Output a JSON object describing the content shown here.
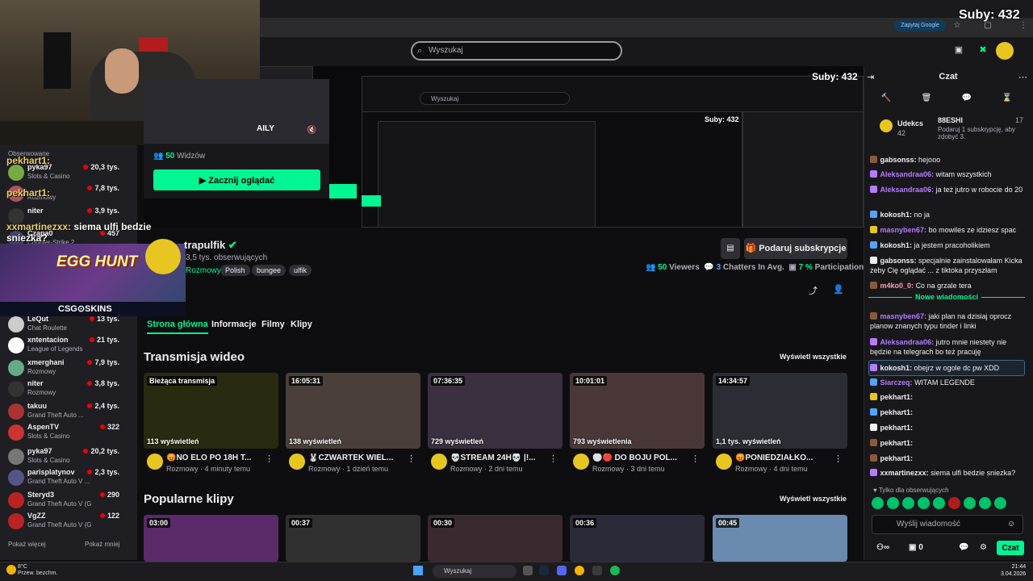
{
  "overlay": {
    "subs_counter": "Suby: 432",
    "nested_subs": "Suby: 432",
    "nested_subs_small": "Suby: 432"
  },
  "browser": {
    "google_btn": "Zapytaj Google"
  },
  "search": {
    "placeholder": "Wyszukaj",
    "nested_placeholder": "Wyszukaj"
  },
  "stream_overlay": {
    "lines": [
      {
        "user": "pekhart1:",
        "msg": ""
      },
      {
        "user": "pekhart1:",
        "msg": ""
      },
      {
        "user": "xxmartinezxx:",
        "msg": "siema ulfi bedzie sniezka?"
      }
    ],
    "egg_hunt": "EGG HUNT",
    "csgoskins": "CSG⊙SKINS",
    "followed_label": "Obserwowane"
  },
  "preview": {
    "caption": "AILY",
    "viewers_count": "50",
    "viewers_label": "Widzów",
    "watch_btn": "Zacznij oglądać"
  },
  "sidebar": {
    "channels": [
      {
        "name": "pyka97",
        "category": "Slots & Casino",
        "viewers": "20,3 tys."
      },
      {
        "name": "",
        "category": "Rozmowy",
        "viewers": "7,8 tys."
      },
      {
        "name": "niter",
        "category": "",
        "viewers": "3,9 tys."
      },
      {
        "name": "Czapa0",
        "category": "Counter-Strike 2",
        "viewers": "457"
      },
      {
        "name": "LeQut",
        "category": "Chat Roulette",
        "viewers": "13 tys."
      },
      {
        "name": "xntentacion",
        "category": "League of Legends",
        "viewers": "21 tys."
      },
      {
        "name": "xmerghani",
        "category": "Rozmowy",
        "viewers": "7,9 tys."
      },
      {
        "name": "niter",
        "category": "Rozmowy",
        "viewers": "3,8 tys."
      },
      {
        "name": "takuu",
        "category": "Grand Theft Auto ...",
        "viewers": "2,4 tys."
      },
      {
        "name": "AspenTV",
        "category": "Slots & Casino",
        "viewers": "322"
      },
      {
        "name": "pyka97",
        "category": "Slots & Casino",
        "viewers": "20,2 tys."
      },
      {
        "name": "parisplatynov",
        "category": "Grand Theft Auto V ...",
        "viewers": "2,3 tys."
      },
      {
        "name": "Steryd3",
        "category": "Grand Theft Auto V (G...",
        "viewers": "290"
      },
      {
        "name": "VgZZ",
        "category": "Grand Theft Auto V (G...",
        "viewers": "122"
      }
    ],
    "show_more": "Pokaż więcej",
    "show_less": "Pokaż mniej"
  },
  "channel": {
    "name": "trapulfik",
    "followers": "3,5 tys. obserwujących",
    "category": "Rozmowy",
    "tags": [
      "Polish",
      "bungee",
      "ulfik"
    ],
    "sub_btn": "Podaruj subskrypcje",
    "viewers_count": "50",
    "viewers_label": "Viewers",
    "chatters_count": "3",
    "chatters_label": "Chatters In Avg.",
    "participation_count": "7 %",
    "participation_label": "Participation"
  },
  "tabs": [
    "Strona główna",
    "Informacje",
    "Filmy",
    "Klipy"
  ],
  "videos_section": {
    "title": "Transmisja wideo",
    "see_all": "Wyświetl wszystkie"
  },
  "videos": [
    {
      "duration": "Bieżąca transmisja",
      "views": "113 wyświetleń",
      "title": "😡NO ELO PO 18H T...",
      "meta": "Rozmowy · 4 minuty temu",
      "bg": "#2a2a10"
    },
    {
      "duration": "16:05:31",
      "views": "138 wyświetleń",
      "title": "🐰CZWARTEK WIEL...",
      "meta": "Rozmowy · 1 dzień temu",
      "bg": "#4a3f3a"
    },
    {
      "duration": "07:36:35",
      "views": "729 wyświetleń",
      "title": "💀STREAM 24H💀 |!...",
      "meta": "Rozmowy · 2 dni temu",
      "bg": "#3a3040"
    },
    {
      "duration": "10:01:01",
      "views": "793 wyświetlenia",
      "title": "⚪🔴 DO BOJU POL...",
      "meta": "Rozmowy · 3 dni temu",
      "bg": "#4a3838"
    },
    {
      "duration": "14:34:57",
      "views": "1,1 tys. wyświetleń",
      "title": "😡PONIEDZIAŁKO...",
      "meta": "Rozmowy · 4 dni temu",
      "bg": "#2c2c34"
    }
  ],
  "clips_section": {
    "title": "Popularne klipy",
    "see_all": "Wyświetl wszystkie"
  },
  "clips": [
    {
      "duration": "03:00",
      "bg": "#5a2a6a"
    },
    {
      "duration": "00:37",
      "bg": "#303030"
    },
    {
      "duration": "00:30",
      "bg": "#3a2a30"
    },
    {
      "duration": "00:36",
      "bg": "#2a2a38"
    },
    {
      "duration": "00:45",
      "bg": "#6a8ab0"
    }
  ],
  "chat": {
    "title": "Czat",
    "leaderboard": {
      "top_user": "Udekcs",
      "top_value": "42",
      "second_user": "88ESHI",
      "second_value": "17",
      "note": "Podaruj 1 subskrypcję, aby zdobyć 3."
    },
    "messages_before": [
      {
        "user": "gabsonss:",
        "text": "hejooo",
        "color": "#efeff1"
      },
      {
        "user": "Aleksandraa06:",
        "text": "witam wszystkich",
        "color": "#b77bff"
      },
      {
        "user": "Aleksandraa06:",
        "text": "ja też jutro w robocie do 20",
        "color": "#b77bff"
      },
      {
        "user": "kokosh1:",
        "text": "no ja",
        "color": "#efeff1"
      },
      {
        "user": "masnyben67:",
        "text": "bo mowiles ze idziesz spac",
        "color": "#b77bff"
      },
      {
        "user": "kokosh1:",
        "text": "ja jestem pracoholikiem",
        "color": "#efeff1"
      },
      {
        "user": "gabsonss:",
        "text": "specjalnie zainstalowałam Kicka żeby Cię oglądać ... z tiktoka przyszłam",
        "color": "#efeff1"
      },
      {
        "user": "m4ko0_0:",
        "text": "Co na grzale tera",
        "color": "#ff9eb0"
      }
    ],
    "new_messages": "Nowe wiadomości",
    "messages_after": [
      {
        "user": "masnyben67:",
        "text": "jaki plan na dzisiaj oprocz planow znanych typu tinder i linki",
        "color": "#b77bff"
      },
      {
        "user": "Aleksandraa06:",
        "text": "jutro mnie niestety nie będzie na telegrach bo też pracuję",
        "color": "#b77bff"
      },
      {
        "user": "kokosh1:",
        "text": "obejrz w ogole dc pw XDD",
        "color": "#efeff1"
      },
      {
        "user": "Siarczeq:",
        "text": "WITAM LEGENDE",
        "color": "#b77bff"
      },
      {
        "user": "pekhart1:",
        "text": "",
        "color": "#efeff1"
      },
      {
        "user": "pekhart1:",
        "text": "",
        "color": "#efeff1"
      },
      {
        "user": "pekhart1:",
        "text": "",
        "color": "#efeff1"
      },
      {
        "user": "pekhart1:",
        "text": "",
        "color": "#efeff1"
      },
      {
        "user": "pekhart1:",
        "text": "",
        "color": "#efeff1"
      },
      {
        "user": "xxmartinezxx:",
        "text": "siema ulfi bedzie sniezka?",
        "color": "#efeff1"
      }
    ],
    "followers_only": "Tylko dla obserwujących",
    "input_placeholder": "Wyślij wiadomość",
    "points": "0",
    "send_btn": "Czat"
  },
  "taskbar": {
    "search": "Wyszukaj",
    "weather_temp": "8°C",
    "weather_desc": "Przew. bezchm.",
    "time": "21:44",
    "date": "3.04.2026"
  },
  "colors": {
    "accent": "#00f593",
    "background": "#0e0e10",
    "panel": "#18181b"
  }
}
